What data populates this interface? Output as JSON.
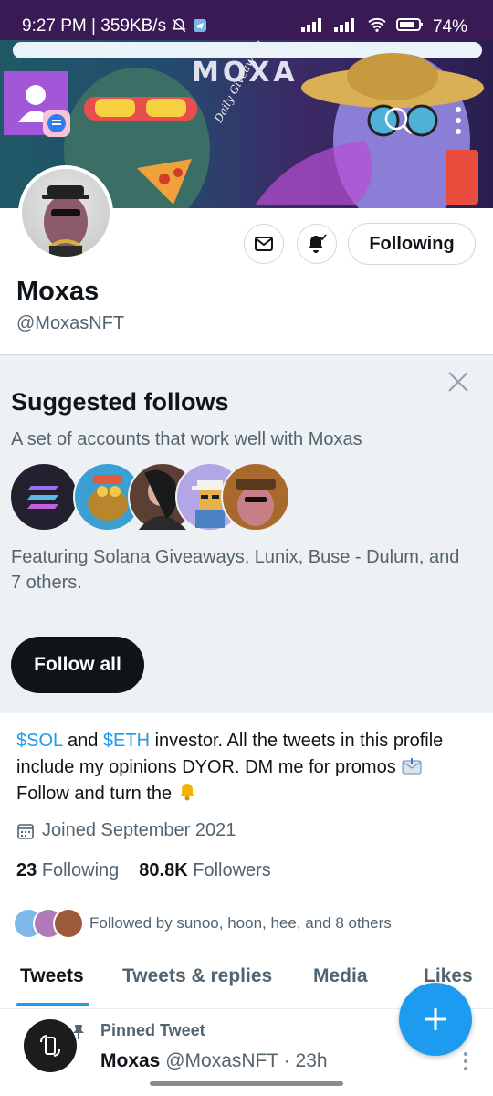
{
  "status_bar": {
    "time": "9:27 PM",
    "speed": "359KB/s",
    "battery": "74%"
  },
  "banner": {
    "title": "MOXA",
    "subtitle": "Daily Giveaways NFT Promoter"
  },
  "profile": {
    "name": "Moxas",
    "handle": "@MoxasNFT",
    "following_button": "Following"
  },
  "suggested": {
    "title": "Suggested follows",
    "description": "A set of accounts that work well with Moxas",
    "featuring": "Featuring Solana Giveaways, Lunix, Buse - Dulum, and 7 others.",
    "follow_all": "Follow all",
    "avatar_colors": [
      "#23202f",
      "#3b9fd1",
      "#5b3f34",
      "#b2a6e6",
      "#a86a2c"
    ]
  },
  "bio": {
    "tag1": "$SOL",
    "and": " and ",
    "tag2": "$ETH",
    "rest1": " investor. All the tweets in this profile include my opinions DYOR. DM me for promos ",
    "rest2": " Follow and turn the ",
    "joined": "Joined September 2021"
  },
  "stats": {
    "following_count": "23",
    "following_label": "Following",
    "followers_count": "80.8K",
    "followers_label": "Followers"
  },
  "followed_by": "Followed by sunoo, hoon, hee, and 8 others",
  "tabs": [
    "Tweets",
    "Tweets & replies",
    "Media",
    "Likes"
  ],
  "pinned": {
    "label": "Pinned Tweet",
    "author_name": "Moxas",
    "author_handle": "@MoxasNFT",
    "time": "23h"
  },
  "colors": {
    "accent": "#1d9bf0",
    "status_bar": "#3a1a55"
  }
}
